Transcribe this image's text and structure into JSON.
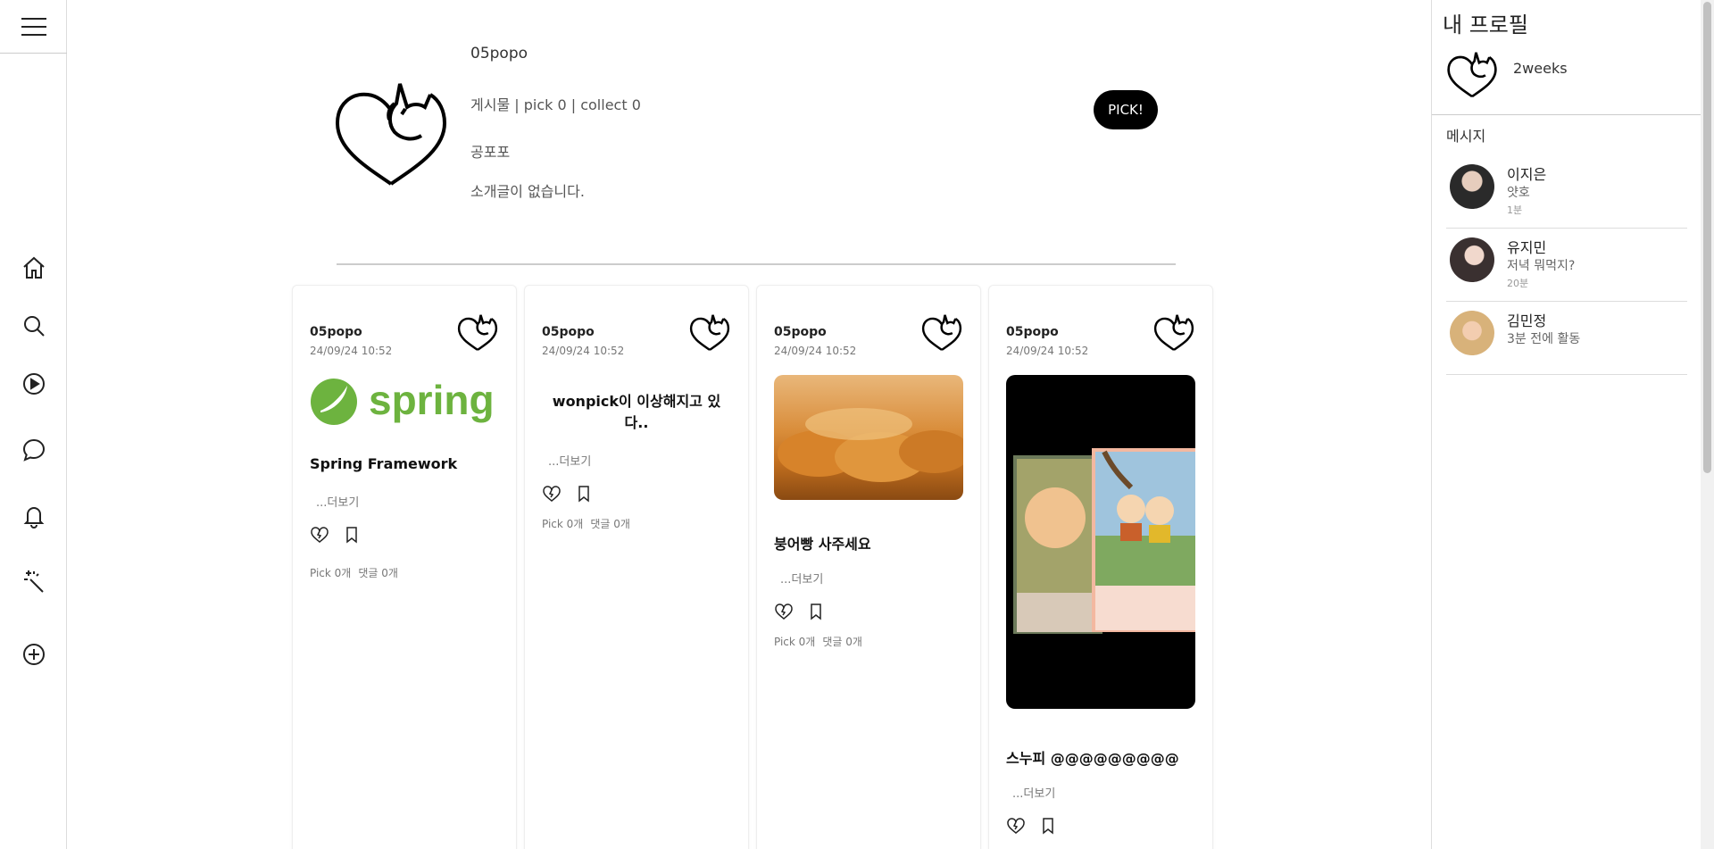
{
  "nav": {
    "items": [
      {
        "name": "home",
        "icon": "home-icon"
      },
      {
        "name": "search",
        "icon": "search-icon"
      },
      {
        "name": "play",
        "icon": "play-icon"
      },
      {
        "name": "chat",
        "icon": "chat-icon"
      },
      {
        "name": "notifications",
        "icon": "bell-icon"
      },
      {
        "name": "magic",
        "icon": "magic-wand-icon"
      },
      {
        "name": "create",
        "icon": "plus-circle-icon"
      }
    ]
  },
  "profile": {
    "username": "05popo",
    "stats": "게시물 | pick 0 | collect 0",
    "nickname": "공포포",
    "bio": "소개글이 없습니다.",
    "pick_button": "PICK!"
  },
  "cards": [
    {
      "author": "05popo",
      "date": "24/09/24 10:52",
      "title": "Spring Framework",
      "more": "...더보기",
      "counts_pick": "Pick 0개",
      "counts_comment": "댓글 0개",
      "image": "spring-logo",
      "image_text": "spring"
    },
    {
      "author": "05popo",
      "date": "24/09/24 10:52",
      "title": "wonpick이 이상해지고 있다..",
      "more": "...더보기",
      "counts_pick": "Pick 0개",
      "counts_comment": "댓글 0개"
    },
    {
      "author": "05popo",
      "date": "24/09/24 10:52",
      "title": "붕어빵 사주세요",
      "more": "...더보기",
      "counts_pick": "Pick 0개",
      "counts_comment": "댓글 0개",
      "image": "fish-bread-photo"
    },
    {
      "author": "05popo",
      "date": "24/09/24 10:52",
      "title": "스누피 @@@@@@@@@",
      "more": "...더보기",
      "image": "snoopy-comic"
    }
  ],
  "right_panel": {
    "title": "내 프로필",
    "username": "2weeks",
    "messages_heading": "메시지",
    "messages": [
      {
        "name": "이지은",
        "text": "얏호",
        "time": "1분"
      },
      {
        "name": "유지민",
        "text": "저녁 뭐먹지?",
        "time": "20분"
      },
      {
        "name": "김민정",
        "text": "3분 전에 활동",
        "time": ""
      }
    ]
  },
  "colors": {
    "accent": "#000000",
    "spring_green": "#6db33f"
  }
}
